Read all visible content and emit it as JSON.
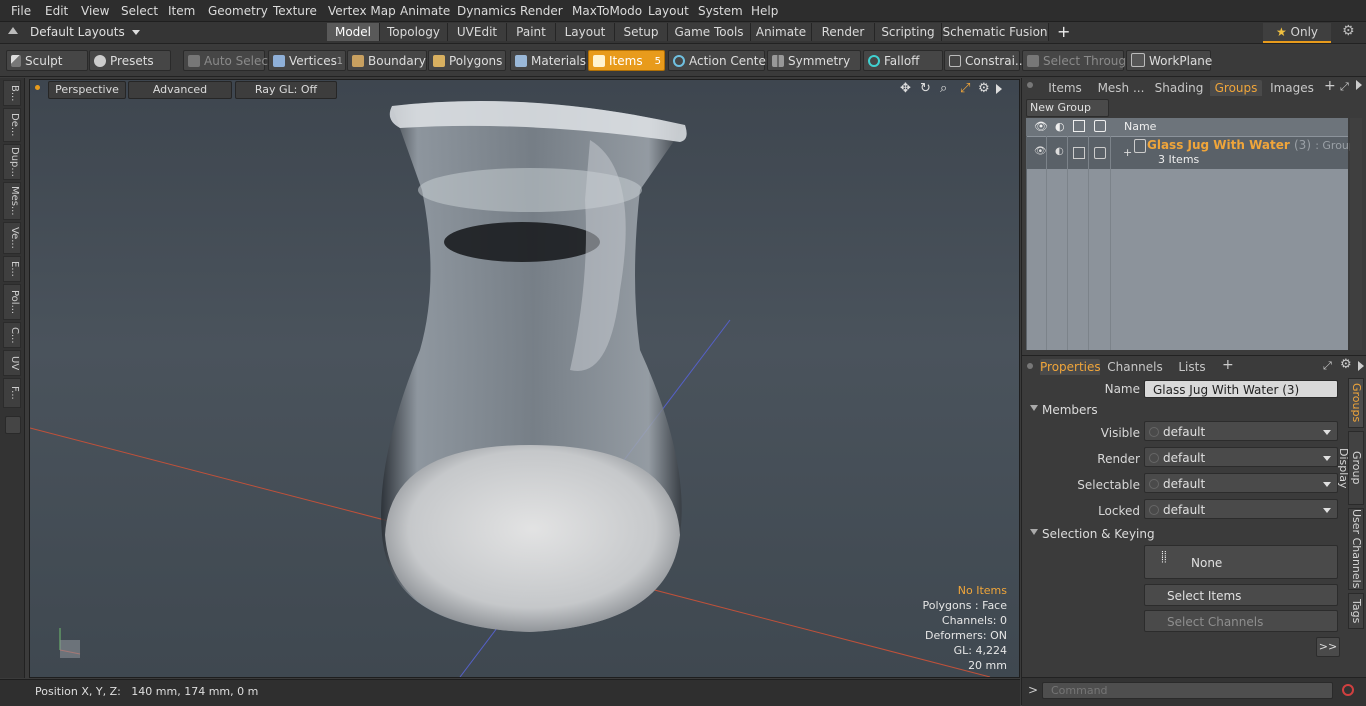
{
  "menu": [
    "File",
    "Edit",
    "View",
    "Select",
    "Item",
    "Geometry",
    "Texture",
    "Vertex Map",
    "Animate",
    "Dynamics",
    "Render",
    "MaxToModo",
    "Layout",
    "System",
    "Help"
  ],
  "layout_bar": {
    "layouts_label": "Default Layouts",
    "tabs": [
      "Model",
      "Topology",
      "UVEdit",
      "Paint",
      "Layout",
      "Setup",
      "Game Tools",
      "Animate",
      "Render",
      "Scripting",
      "Schematic Fusion"
    ],
    "active_tab": "Model",
    "plus": "+",
    "only_label": "Only"
  },
  "toolbar": {
    "sculpt": "Sculpt",
    "presets": "Presets",
    "auto_select": "Auto Select",
    "vertices": "Vertices",
    "vertices_count": "1",
    "boundary": "Boundary",
    "polygons": "Polygons",
    "materials": "Materials",
    "items": "Items",
    "items_count": "5",
    "action_center": "Action Center",
    "symmetry": "Symmetry",
    "falloff": "Falloff",
    "constraints": "Constrai...",
    "select_through": "Select Through",
    "workplane": "WorkPlane"
  },
  "left_tabs": [
    "B...",
    "De...",
    "Dup...",
    "Mes...",
    "Ve...",
    "E...",
    "Pol...",
    "C...",
    "UV",
    "F..."
  ],
  "viewport": {
    "perspective": "Perspective",
    "advanced": "Advanced",
    "raygl": "Ray GL: Off",
    "stats": {
      "no_items": "No Items",
      "polygons": "Polygons : Face",
      "channels": "Channels: 0",
      "deformers": "Deformers: ON",
      "gl": "GL: 4,224",
      "scale": "20 mm"
    }
  },
  "status": {
    "position": "Position X, Y, Z:   140 mm, 174 mm, 0 m"
  },
  "groups_panel": {
    "tabs": [
      "Items",
      "Mesh ...",
      "Shading",
      "Groups",
      "Images"
    ],
    "active_tab": "Groups",
    "plus": "+",
    "new_group": "New Group",
    "col_name": "Name",
    "row_name": "Glass Jug With Water",
    "row_count": "(3)",
    "row_type": ": Group",
    "row_items": "3 Items"
  },
  "props_panel": {
    "tabs": [
      "Properties",
      "Channels",
      "Lists"
    ],
    "active_tab": "Properties",
    "plus": "+",
    "name_label": "Name",
    "name_value": "Glass Jug With Water (3)",
    "members": "Members",
    "visible_label": "Visible",
    "visible_value": "default",
    "render_label": "Render",
    "render_value": "default",
    "selectable_label": "Selectable",
    "selectable_value": "default",
    "locked_label": "Locked",
    "locked_value": "default",
    "sel_keying": "Selection & Keying",
    "none": "None",
    "select_items": "Select Items",
    "select_channels": "Select Channels",
    "more": ">>",
    "side_tabs": [
      "Groups",
      "Group Display",
      "User Channels",
      "Tags"
    ]
  },
  "command": {
    "prompt": ">",
    "placeholder": "Command"
  },
  "colors": {
    "accent": "#e89b1c",
    "active_text": "#f0a53a"
  }
}
